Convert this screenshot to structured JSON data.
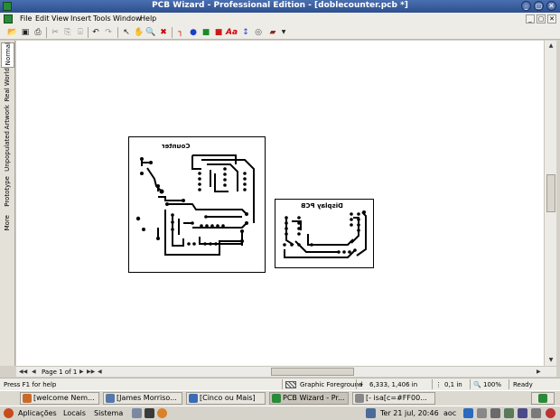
{
  "window": {
    "title": "PCB Wizard - Professional Edition - [doblecounter.pcb *]",
    "controls": [
      "_",
      "▢",
      "✕"
    ]
  },
  "menu": {
    "items": [
      "File",
      "Edit",
      "View",
      "Insert",
      "Tools",
      "Window",
      "Help"
    ],
    "mdi_controls": [
      "_",
      "▢",
      "✕"
    ]
  },
  "side_tabs": [
    "Normal",
    "Real World",
    "Artwork",
    "Unpopulated",
    "Prototype",
    "More"
  ],
  "boards": [
    {
      "label": "Counter"
    },
    {
      "label": "Display PCB"
    }
  ],
  "page_nav": {
    "page_text": "Page 1 of 1"
  },
  "status": {
    "help": "Press F1 for help",
    "layer": "Graphic Foreground",
    "coords": "6,333, 1,406 in",
    "grid": "0,1 in",
    "zoom": "100%",
    "state": "Ready"
  },
  "taskbar": {
    "tasks": [
      {
        "label": "[welcome Nem...",
        "color": "#c96a2b"
      },
      {
        "label": "[James Morriso...",
        "color": "#5577aa"
      },
      {
        "label": "[Cinco ou Mais]",
        "color": "#3b6bb5"
      },
      {
        "label": "PCB Wizard - Pr...",
        "color": "#2a8a3a"
      },
      {
        "label": "[- isa[c=#FF00...",
        "color": "#888888"
      }
    ]
  },
  "panel": {
    "applications": "Aplicações",
    "places": "Locais",
    "system": "Sistema",
    "clock": "Ter 21 jul, 20:46",
    "user": "aoc"
  }
}
